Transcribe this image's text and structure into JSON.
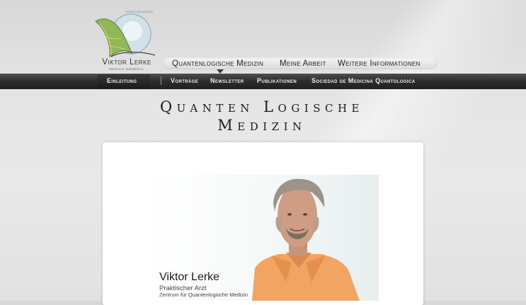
{
  "logo": {
    "name": "Viktor Lerke",
    "subtitle": "MEDICO GENERAL"
  },
  "top_nav": {
    "items": [
      {
        "label": "Quantenlogische Medizin"
      },
      {
        "label": "Meine Arbeit"
      },
      {
        "label": "Weitere Informationen"
      }
    ]
  },
  "sub_nav": {
    "items": [
      {
        "label": "Einleitung",
        "active": true
      },
      {
        "label": "Vorträge"
      },
      {
        "label": "Newsletter"
      },
      {
        "label": "Publikationen"
      },
      {
        "label": "Sociedad de Medicina Quantologica"
      }
    ]
  },
  "page": {
    "title_line1": "Quanten Logische",
    "title_line2": "Medizin"
  },
  "video": {
    "caption_name": "Viktor Lerke",
    "caption_title": "Praktischer Arzt",
    "caption_org": "Zentrum für Quantenlogische Medizin"
  },
  "colors": {
    "subnav_bg": "#2b2b2b",
    "page_bg": "#e6e6e6",
    "shirt": "#f0a060"
  }
}
